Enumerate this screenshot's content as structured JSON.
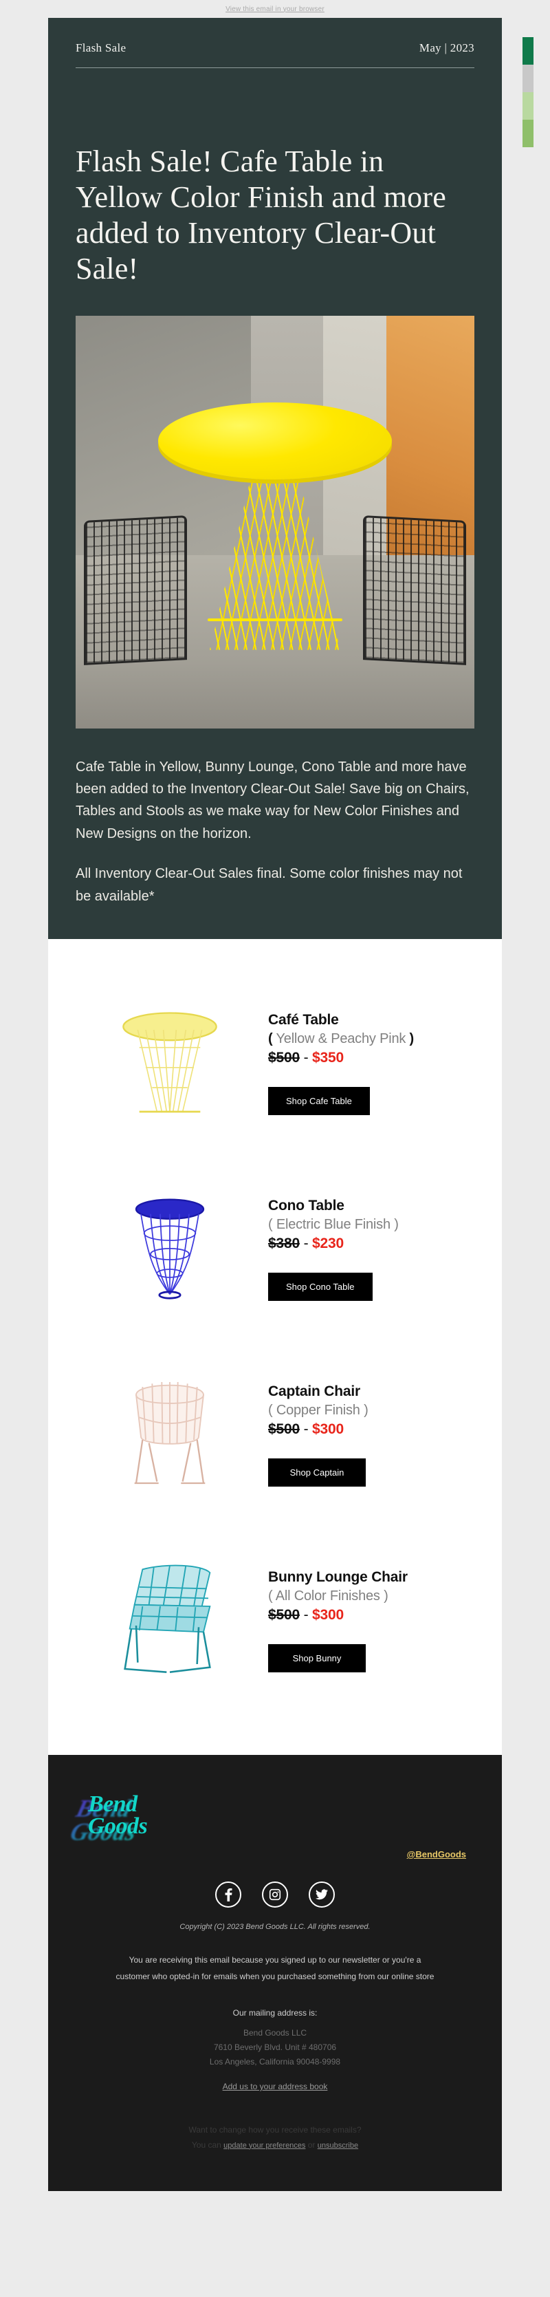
{
  "preheader": {
    "view_in_browser": "View this email in your browser"
  },
  "header": {
    "brand_label": "Flash Sale",
    "date_label": "May | 2023"
  },
  "hero": {
    "title": "Flash Sale! Cafe Table in Yellow Color Finish and more added to Inventory Clear-Out Sale!",
    "paragraph_1": "Cafe Table in Yellow, Bunny Lounge, Cono Table and more have been added to the Inventory Clear-Out Sale! Save big on Chairs, Tables and Stools as we make way for New Color Finishes and New Designs on the horizon.",
    "paragraph_2": "All Inventory Clear-Out Sales final. Some color finishes may not be available*",
    "image_alt": "yellow cafe table between two black wire chairs",
    "background_color": "#2d3c3b"
  },
  "swatches": [
    "#0f7a4a",
    "#c8c8c8",
    "#b9d9a0",
    "#8fbf6a"
  ],
  "products": [
    {
      "name": "Café Table",
      "finish": "( Yellow & Peachy Pink )",
      "finish_open": "(",
      "finish_text": " Yellow & Peachy Pink ",
      "finish_close": ")",
      "price_old": "$500",
      "price_dash": "-",
      "price_new": "$350",
      "cta": "Shop Cafe Table",
      "color": "#f5e96b",
      "icon": "cafe-table-illustration"
    },
    {
      "name": "Cono Table",
      "finish": "( Electric Blue Finish )",
      "finish_open": "(",
      "finish_text": " Electric Blue Finish ",
      "finish_close": ")",
      "price_old": "$380",
      "price_dash": "-",
      "price_new": "$230",
      "cta": "Shop Cono Table",
      "color": "#2a28c8",
      "icon": "cono-table-illustration"
    },
    {
      "name": "Captain Chair",
      "finish": "( Copper Finish )",
      "finish_open": "(",
      "finish_text": " Copper Finish ",
      "finish_close": ")",
      "price_old": "$500",
      "price_dash": "-",
      "price_new": "$300",
      "cta": "Shop Captain",
      "color": "#f0d9cf",
      "icon": "captain-chair-illustration"
    },
    {
      "name": "Bunny Lounge Chair",
      "finish": "( All Color Finishes )",
      "finish_open": "(",
      "finish_text": " All Color Finishes ",
      "finish_close": ")",
      "price_old": "$500",
      "price_dash": "-",
      "price_new": "$300",
      "cta": "Shop Bunny",
      "color": "#22a5b5",
      "icon": "bunny-lounge-chair-illustration"
    }
  ],
  "footer": {
    "logo_line_1": "Bend",
    "logo_line_2": "Goods",
    "handle": "@BendGoods",
    "social": [
      {
        "name": "facebook",
        "label": "Facebook"
      },
      {
        "name": "instagram",
        "label": "Instagram"
      },
      {
        "name": "twitter",
        "label": "Twitter"
      }
    ],
    "copyright": "Copyright (C) 2023 Bend Goods LLC. All rights reserved.",
    "optin_line_1": "You are receiving this email because you signed up to our newsletter or you're a",
    "optin_line_2": "customer who opted-in for emails when you purchased something from our online store",
    "mailing_label": "Our mailing address is:",
    "address_line_1": "Bend Goods LLC",
    "address_line_2": "7610 Beverly Blvd. Unit # 480706",
    "address_line_3": "Los Angeles, California 90048-9998",
    "address_book_link": "Add us to your address book",
    "prefs_line_1": "Want to change how you receive these emails?",
    "prefs_prefix": "You can ",
    "prefs_link_1": "update your preferences",
    "prefs_or": " or ",
    "prefs_link_2": "unsubscribe",
    "accent_handle_color": "#e8c867",
    "logo_color": "#12d6c8",
    "background_color": "#1b1b1b"
  }
}
